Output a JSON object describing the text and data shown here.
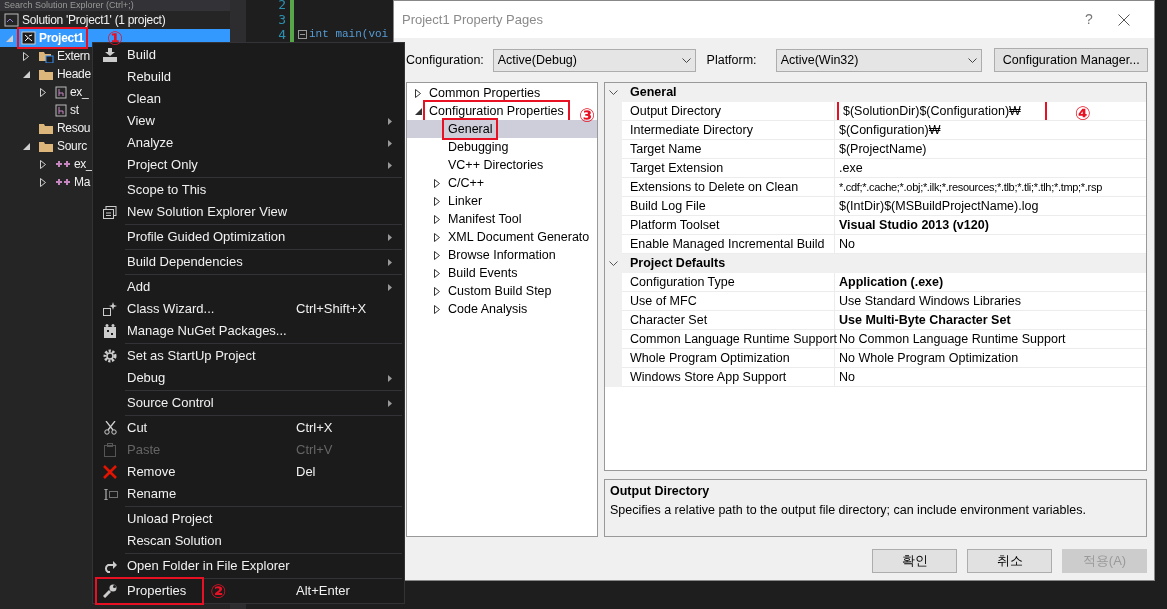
{
  "explorer": {
    "search_placeholder": "Search Solution Explorer (Ctrl+;)",
    "tree": [
      {
        "kind": "solution",
        "label": "Solution 'Project1' (1 project)",
        "selected": false,
        "children": [
          {
            "kind": "project",
            "label": "Project1",
            "selected": true,
            "expanded": true,
            "highlighted": true,
            "annotation": "①",
            "children": [
              {
                "kind": "references",
                "label": "Extern",
                "selected": false,
                "expanded": false
              },
              {
                "kind": "filter",
                "label": "Heade",
                "selected": false,
                "expanded": true,
                "children": [
                  {
                    "kind": "header",
                    "label": "ex_",
                    "selected": false,
                    "expanded": false
                  },
                  {
                    "kind": "header",
                    "label": "st",
                    "selected": false
                  }
                ]
              },
              {
                "kind": "folder",
                "label": "Resou",
                "selected": false
              },
              {
                "kind": "filter",
                "label": "Sourc",
                "selected": false,
                "expanded": true,
                "children": [
                  {
                    "kind": "source",
                    "label": "ex_",
                    "selected": false,
                    "expanded": false
                  },
                  {
                    "kind": "source",
                    "label": "Ma",
                    "selected": false,
                    "expanded": false
                  }
                ]
              }
            ]
          }
        ]
      }
    ]
  },
  "editor": {
    "lines": [
      {
        "number": "2",
        "fold": false
      },
      {
        "number": "3",
        "fold": false
      },
      {
        "number": "4",
        "code": "int main(voi",
        "fold": true
      }
    ]
  },
  "context_menu": {
    "items": [
      {
        "kind": "item",
        "label": "Build",
        "submenu": false,
        "disabled": false
      },
      {
        "kind": "item",
        "label": "Rebuild",
        "submenu": false,
        "disabled": false
      },
      {
        "kind": "item",
        "label": "Clean",
        "submenu": false,
        "disabled": false
      },
      {
        "kind": "item",
        "label": "View",
        "submenu": true,
        "disabled": false
      },
      {
        "kind": "item",
        "label": "Analyze",
        "submenu": true,
        "disabled": false
      },
      {
        "kind": "item",
        "label": "Project Only",
        "submenu": true,
        "disabled": false
      },
      {
        "kind": "separator"
      },
      {
        "kind": "item",
        "label": "Scope to This",
        "submenu": false,
        "disabled": false
      },
      {
        "kind": "item",
        "label": "New Solution Explorer View",
        "submenu": false,
        "disabled": false
      },
      {
        "kind": "separator"
      },
      {
        "kind": "item",
        "label": "Profile Guided Optimization",
        "submenu": true,
        "disabled": false
      },
      {
        "kind": "separator"
      },
      {
        "kind": "item",
        "label": "Build Dependencies",
        "submenu": true,
        "disabled": false
      },
      {
        "kind": "separator"
      },
      {
        "kind": "item",
        "label": "Add",
        "submenu": true,
        "disabled": false
      },
      {
        "kind": "item",
        "label": "Class Wizard...",
        "shortcut": "Ctrl+Shift+X",
        "submenu": false,
        "disabled": false
      },
      {
        "kind": "item",
        "label": "Manage NuGet Packages...",
        "submenu": false,
        "disabled": false
      },
      {
        "kind": "separator"
      },
      {
        "kind": "item",
        "label": "Set as StartUp Project",
        "submenu": false,
        "disabled": false
      },
      {
        "kind": "item",
        "label": "Debug",
        "submenu": true,
        "disabled": false
      },
      {
        "kind": "separator"
      },
      {
        "kind": "item",
        "label": "Source Control",
        "submenu": true,
        "disabled": false
      },
      {
        "kind": "separator"
      },
      {
        "kind": "item",
        "label": "Cut",
        "shortcut": "Ctrl+X",
        "submenu": false,
        "disabled": false
      },
      {
        "kind": "item",
        "label": "Paste",
        "shortcut": "Ctrl+V",
        "submenu": false,
        "disabled": true
      },
      {
        "kind": "item",
        "label": "Remove",
        "shortcut": "Del",
        "submenu": false,
        "disabled": false
      },
      {
        "kind": "item",
        "label": "Rename",
        "submenu": false,
        "disabled": false
      },
      {
        "kind": "separator"
      },
      {
        "kind": "item",
        "label": "Unload Project",
        "submenu": false,
        "disabled": false
      },
      {
        "kind": "item",
        "label": "Rescan Solution",
        "submenu": false,
        "disabled": false
      },
      {
        "kind": "separator"
      },
      {
        "kind": "item",
        "label": "Open Folder in File Explorer",
        "submenu": false,
        "disabled": false
      },
      {
        "kind": "separator"
      },
      {
        "kind": "item",
        "label": "Properties",
        "shortcut": "Alt+Enter",
        "submenu": false,
        "disabled": false,
        "highlighted": true,
        "annotation": "②"
      }
    ]
  },
  "dialog": {
    "title": "Project1 Property Pages",
    "help": "?",
    "configuration": {
      "label": "Configuration:",
      "value": "Active(Debug)"
    },
    "platform": {
      "label": "Platform:",
      "value": "Active(Win32)"
    },
    "manager_button": "Configuration Manager...",
    "tree": [
      {
        "label": "Common Properties",
        "selected": false,
        "expanded": false
      },
      {
        "label": "Configuration Properties",
        "selected": false,
        "expanded": true,
        "highlighted": true,
        "annotation": "③",
        "children": [
          {
            "label": "General",
            "selected": true,
            "highlighted": true
          },
          {
            "label": "Debugging",
            "selected": false
          },
          {
            "label": "VC++ Directories",
            "selected": false
          },
          {
            "label": "C/C++",
            "selected": false,
            "expanded": false
          },
          {
            "label": "Linker",
            "selected": false,
            "expanded": false
          },
          {
            "label": "Manifest Tool",
            "selected": false,
            "expanded": false
          },
          {
            "label": "XML Document Generato",
            "selected": false,
            "expanded": false
          },
          {
            "label": "Browse Information",
            "selected": false,
            "expanded": false
          },
          {
            "label": "Build Events",
            "selected": false,
            "expanded": false
          },
          {
            "label": "Custom Build Step",
            "selected": false,
            "expanded": false
          },
          {
            "label": "Code Analysis",
            "selected": false,
            "expanded": false
          }
        ]
      }
    ],
    "grid": [
      {
        "title": "General",
        "expanded": true,
        "rows": [
          {
            "name": "Output Directory",
            "value": "$(SolutionDir)$(Configuration)₩",
            "bold": false,
            "highlighted": true,
            "annotation": "④"
          },
          {
            "name": "Intermediate Directory",
            "value": "$(Configuration)₩",
            "bold": false
          },
          {
            "name": "Target Name",
            "value": "$(ProjectName)",
            "bold": false
          },
          {
            "name": "Target Extension",
            "value": ".exe",
            "bold": false
          },
          {
            "name": "Extensions to Delete on Clean",
            "value": "*.cdf;*.cache;*.obj;*.ilk;*.resources;*.tlb;*.tli;*.tlh;*.tmp;*.rsp",
            "bold": false
          },
          {
            "name": "Build Log File",
            "value": "$(IntDir)$(MSBuildProjectName).log",
            "bold": false
          },
          {
            "name": "Platform Toolset",
            "value": "Visual Studio 2013 (v120)",
            "bold": true
          },
          {
            "name": "Enable Managed Incremental Build",
            "value": "No",
            "bold": false
          }
        ]
      },
      {
        "title": "Project Defaults",
        "expanded": true,
        "rows": [
          {
            "name": "Configuration Type",
            "value": "Application (.exe)",
            "bold": true
          },
          {
            "name": "Use of MFC",
            "value": "Use Standard Windows Libraries",
            "bold": false
          },
          {
            "name": "Character Set",
            "value": "Use Multi-Byte Character Set",
            "bold": true
          },
          {
            "name": "Common Language Runtime Support",
            "value": "No Common Language Runtime Support",
            "bold": false
          },
          {
            "name": "Whole Program Optimization",
            "value": "No Whole Program Optimization",
            "bold": false
          },
          {
            "name": "Windows Store App Support",
            "value": "No",
            "bold": false
          }
        ]
      }
    ],
    "description": {
      "title": "Output Directory",
      "text": "Specifies a relative path to the output file directory; can include environment variables."
    },
    "buttons": [
      {
        "label": "확인",
        "disabled": false
      },
      {
        "label": "취소",
        "disabled": false
      },
      {
        "label": "적용(A)",
        "disabled": true
      }
    ]
  }
}
